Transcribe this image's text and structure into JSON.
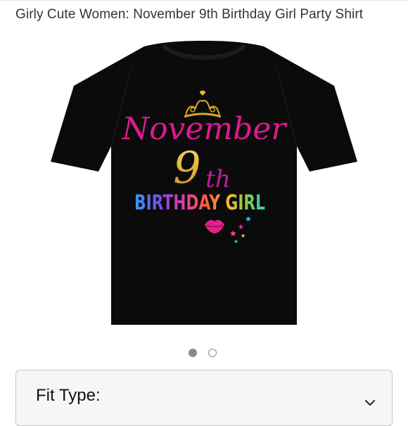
{
  "product": {
    "title": "Girly Cute Women: November 9th Birthday Girl Party Shirt"
  },
  "shirt_print": {
    "month": "November",
    "day_number": "9",
    "day_suffix": "th",
    "tagline": "BIRTHDAY GIRL",
    "shirt_color": "#0b0b0c"
  },
  "carousel": {
    "total": 2,
    "active_index": 1
  },
  "fit_type": {
    "label": "Fit Type:"
  },
  "colors": {
    "month_text": "#e0188e",
    "number_gold": "#e0b52a",
    "suffix_magenta": "#c21b9a"
  },
  "icons": {
    "tiara": "tiara-icon",
    "lips": "lips-icon",
    "stars": "stars-icon",
    "chevron": "chevron-down-icon"
  }
}
